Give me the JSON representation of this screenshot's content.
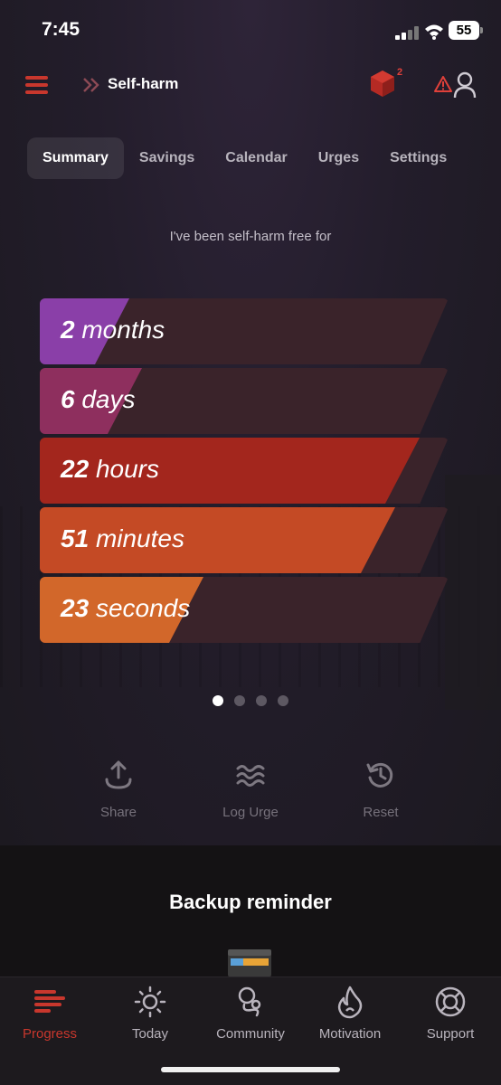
{
  "status_bar": {
    "time": "7:45",
    "battery": "55"
  },
  "header": {
    "title": "Self-harm",
    "badge_count": "2"
  },
  "tabs": [
    {
      "label": "Summary"
    },
    {
      "label": "Savings"
    },
    {
      "label": "Calendar"
    },
    {
      "label": "Urges"
    },
    {
      "label": "Settings"
    }
  ],
  "summary": {
    "intro": "I've been self-harm free for",
    "counters": [
      {
        "value": "2",
        "unit": "months",
        "color": "#8a3fa8",
        "fill_fraction": 0.22
      },
      {
        "value": "6",
        "unit": "days",
        "color": "#8e2f5e",
        "fill_fraction": 0.25
      },
      {
        "value": "22",
        "unit": "hours",
        "color": "#a3261d",
        "fill_fraction": 0.93
      },
      {
        "value": "51",
        "unit": "minutes",
        "color": "#c44a25",
        "fill_fraction": 0.87
      },
      {
        "value": "23",
        "unit": "seconds",
        "color": "#d2672a",
        "fill_fraction": 0.4
      }
    ],
    "page_dots": 4,
    "active_dot": 0
  },
  "actions": {
    "share": "Share",
    "log_urge": "Log Urge",
    "reset": "Reset"
  },
  "backup": {
    "title": "Backup reminder"
  },
  "bottom_nav": [
    {
      "label": "Progress",
      "icon": "progress-bars-icon",
      "active": true
    },
    {
      "label": "Today",
      "icon": "sun-icon",
      "active": false
    },
    {
      "label": "Community",
      "icon": "community-icon",
      "active": false
    },
    {
      "label": "Motivation",
      "icon": "flame-icon",
      "active": false
    },
    {
      "label": "Support",
      "icon": "lifebuoy-icon",
      "active": false
    }
  ],
  "colors": {
    "accent": "#c8372d",
    "track": "#3a232a"
  }
}
